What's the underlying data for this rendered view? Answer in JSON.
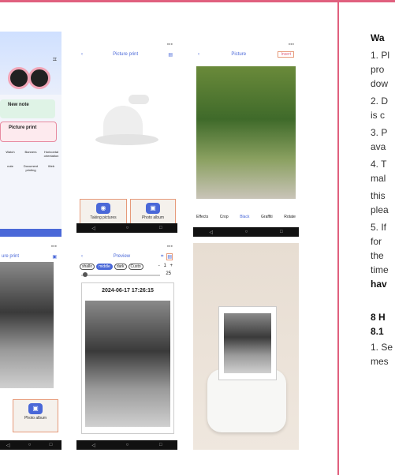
{
  "screen1": {
    "new_note": "New note",
    "picture_print": "Picture print",
    "grid": [
      "Watch",
      "Banners",
      "Horizontal orientation",
      "note",
      "Document printing",
      "Web"
    ],
    "photo_album": "Photo album",
    "title": "ure print"
  },
  "screen2": {
    "title": "Picture print",
    "taking_pictures": "Taking pictures",
    "photo_album": "Photo album"
  },
  "screen3": {
    "title": "Picture",
    "insert": "Insert",
    "tools": [
      "Effects",
      "Crop",
      "Black",
      "Graffiti",
      "Rotate"
    ]
  },
  "screen4": {
    "title": "Preview",
    "modes": [
      "shallo",
      "middle",
      "dark",
      "Custo"
    ],
    "qty_minus": "-",
    "qty": "1",
    "qty_plus": "+",
    "level": "25",
    "timestamp": "2024-06-17 17:26:15"
  },
  "text": {
    "lines": [
      {
        "t": "Wa",
        "b": true
      },
      {
        "t": "1. Pl",
        "b": false
      },
      {
        "t": "pro",
        "b": false
      },
      {
        "t": "dow",
        "b": false
      },
      {
        "t": "2. D",
        "b": false
      },
      {
        "t": "is c",
        "b": false
      },
      {
        "t": "3. P",
        "b": false
      },
      {
        "t": "ava",
        "b": false
      },
      {
        "t": "4. T",
        "b": false
      },
      {
        "t": "mal",
        "b": false
      },
      {
        "t": "this",
        "b": false
      },
      {
        "t": "plea",
        "b": false
      },
      {
        "t": "5. If",
        "b": false
      },
      {
        "t": "for",
        "b": false
      },
      {
        "t": "the",
        "b": false
      },
      {
        "t": "time",
        "b": false
      },
      {
        "t": "hav",
        "b": true
      },
      {
        "t": "",
        "b": false
      },
      {
        "t": "8 H",
        "b": true
      },
      {
        "t": "8.1",
        "b": true
      },
      {
        "t": "1. Se",
        "b": false
      },
      {
        "t": "mes",
        "b": false
      }
    ]
  }
}
